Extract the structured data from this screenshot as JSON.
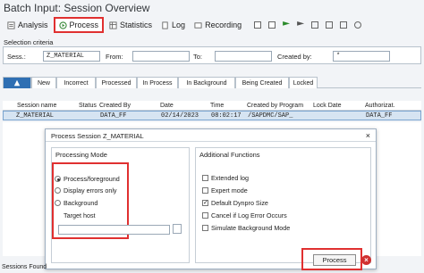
{
  "title": "Batch Input: Session Overview",
  "toolbar": {
    "analysis": "Analysis",
    "process": "Process",
    "statistics": "Statistics",
    "log": "Log",
    "recording": "Recording"
  },
  "criteria": {
    "section_label": "Selection criteria",
    "sess_label": "Sess.:",
    "sess_value": "Z_MATERIAL",
    "from_label": "From:",
    "to_label": "To:",
    "created_by_label": "Created by:",
    "created_by_value": "*"
  },
  "tabs": [
    "New",
    "Incorrect",
    "Processed",
    "In Process",
    "In Background",
    "Being Created",
    "Locked"
  ],
  "table": {
    "headers": [
      "Session name",
      "Status",
      "Created By",
      "Date",
      "Time",
      "Created by Program",
      "Lock Date",
      "Authorizat."
    ],
    "row": {
      "session": "Z_MATERIAL",
      "created_by": "DATA_FF",
      "date": "02/14/2023",
      "time": "08:02:17",
      "program": "/SAPDMC/SAP_",
      "authorization": "DATA_FF"
    }
  },
  "dialog": {
    "title": "Process Session Z_MATERIAL",
    "processing_mode": "Processing Mode",
    "modes": [
      "Process/foreground",
      "Display errors only",
      "Background"
    ],
    "target_host": "Target host",
    "additional_functions": "Additional Functions",
    "functions": [
      {
        "label": "Extended log",
        "checked": false
      },
      {
        "label": "Expert mode",
        "checked": false
      },
      {
        "label": "Default Dynpro Size",
        "checked": true
      },
      {
        "label": "Cancel if Log Error Occurs",
        "checked": false
      },
      {
        "label": "Simulate Background Mode",
        "checked": false
      }
    ],
    "process_button": "Process"
  },
  "status": "Sessions Found"
}
